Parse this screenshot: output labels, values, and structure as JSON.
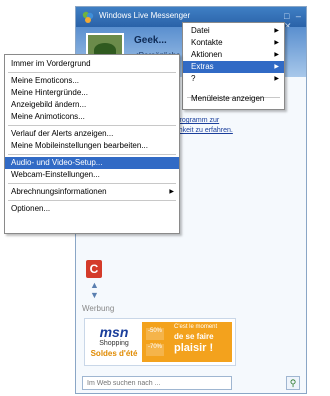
{
  "window": {
    "title": "Windows Live Messenger",
    "controls": "□ ‒ ✕"
  },
  "profile": {
    "nickname": "Geek...",
    "personal_message": "<Persönliche"
  },
  "alert_text": {
    "line1": "m mehr über das Programm zur",
    "line2": "r Benutzerfreundlichkeit zu erfahren."
  },
  "contacts_fragment": "s",
  "contact_tile_letter": "C",
  "ad": {
    "label": "Werbung",
    "msn_logo": "msn",
    "shopping": "Shopping",
    "soldes": "Soldes d'été",
    "line1": "C'est le moment",
    "line2": "de se faire",
    "line3": "plaisir !",
    "pct1": "-50%",
    "pct2": "-70%"
  },
  "search": {
    "placeholder": "Im Web suchen nach ..."
  },
  "menubar": {
    "items": [
      {
        "label": "Datei",
        "arrow": "▶"
      },
      {
        "label": "Kontakte",
        "arrow": "▶"
      },
      {
        "label": "Aktionen",
        "arrow": "▶"
      },
      {
        "label": "Extras",
        "arrow": "▶"
      },
      {
        "label": "?",
        "arrow": "▶"
      },
      {
        "label": "Menüleiste anzeigen",
        "arrow": ""
      }
    ]
  },
  "extras_menu": {
    "items": [
      {
        "label": "Immer im Vordergrund"
      },
      {
        "label": "Meine Emoticons..."
      },
      {
        "label": "Meine Hintergründe..."
      },
      {
        "label": "Anzeigebild ändern..."
      },
      {
        "label": "Meine Animoticons..."
      },
      {
        "label": "Verlauf der Alerts anzeigen..."
      },
      {
        "label": "Meine Mobileinstellungen bearbeiten..."
      },
      {
        "label": "Audio- und Video-Setup..."
      },
      {
        "label": "Webcam-Einstellungen..."
      },
      {
        "label": "Abrechnungsinformationen",
        "arrow": "▶"
      },
      {
        "label": "Optionen..."
      }
    ]
  },
  "colors": {
    "highlight": "#316ac5",
    "title_bar": "#2a62a8"
  }
}
